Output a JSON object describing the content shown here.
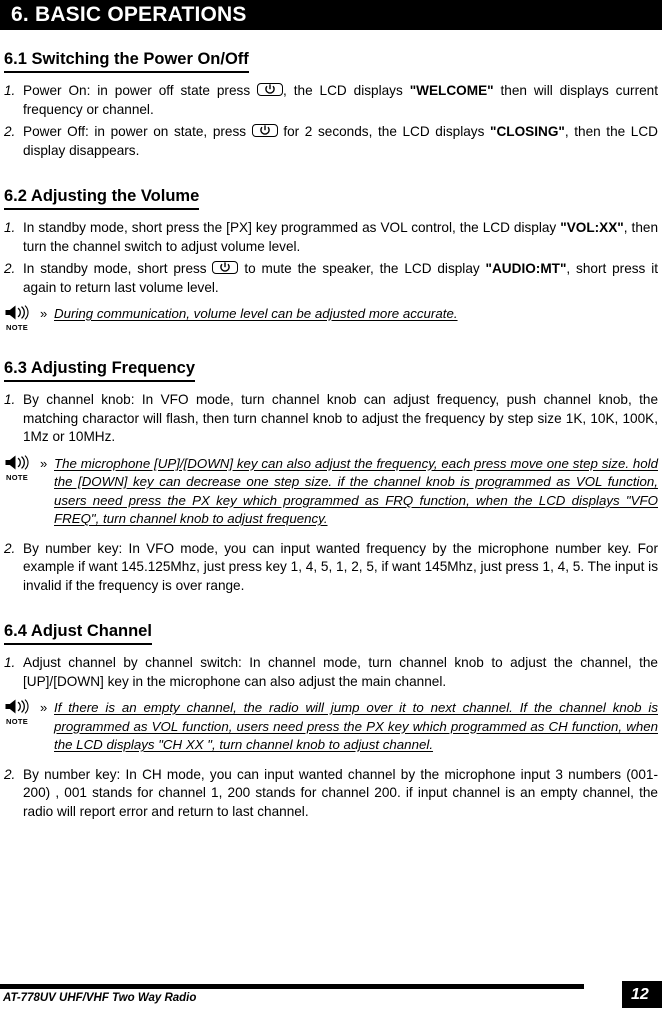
{
  "chapter": {
    "title": "6. BASIC OPERATIONS"
  },
  "sections": {
    "s61": {
      "heading": "6.1 Switching the Power On/Off",
      "item1_num": "1.",
      "item1_a": "Power On: in power off state press",
      "item1_b": ", the LCD displays ",
      "item1_bold": "\"WELCOME\"",
      "item1_c": " then will displays current frequency or channel.",
      "item2_num": "2.",
      "item2_a": "Power Off: in power on state, press",
      "item2_b": " for 2 seconds, the LCD displays ",
      "item2_bold": "\"CLOSING\"",
      "item2_c": ", then the LCD display disappears."
    },
    "s62": {
      "heading": "6.2 Adjusting the Volume",
      "item1_num": "1.",
      "item1_a": "In standby mode, short press the [PX] key programmed as VOL control, the LCD display ",
      "item1_bold": "\"VOL:XX\"",
      "item1_b": ", then turn the channel switch to adjust volume level.",
      "item2_num": "2.",
      "item2_a": "In standby mode, short press",
      "item2_b": " to mute the speaker, the LCD display ",
      "item2_bold": "\"AUDIO:MT\"",
      "item2_c": ", short press it again to return last volume level.",
      "note_text": "During communication, volume level can be adjusted more accurate."
    },
    "s63": {
      "heading": "6.3 Adjusting Frequency",
      "item1_num": "1.",
      "item1_text": "By channel knob: In VFO mode, turn channel knob can adjust frequency,  push channel knob, the matching charactor will flash, then turn channel knob to adjust the frequency by step size 1K, 10K, 100K, 1Mz or 10MHz.",
      "note_text": "The microphone [UP]/[DOWN] key can also adjust the frequency, each press move one step size. hold the [DOWN] key can decrease one step size. if the channel knob is programmed as VOL function, users need press the PX key which programmed as FRQ function, when the LCD displays \"VFO FREQ\",  turn channel knob to adjust frequency.",
      "item2_num": "2.",
      "item2_text": "By number key: In VFO mode, you can input wanted frequency by the microphone number key. For example if want 145.125Mhz, just press key 1, 4, 5, 1, 2, 5, if want 145Mhz, just press 1, 4, 5. The input is invalid if the frequency is over range."
    },
    "s64": {
      "heading": "6.4 Adjust Channel",
      "item1_num": "1.",
      "item1_text": "Adjust channel by channel switch: In channel mode, turn channel knob to adjust the channel, the [UP]/[DOWN] key in the microphone can also adjust the main channel.",
      "note_text": " If there is an empty channel, the radio will jump over it to next channel. If the channel knob is programmed as VOL function, users need press the PX key which programmed as CH function, when the LCD displays \"CH XX \", turn channel knob to adjust channel.",
      "item2_num": "2.",
      "item2_text": "By number key: In CH mode, you can input wanted channel by the microphone input 3 numbers (001-200) ,  001 stands for channel 1, 200 stands for channel 200. if input channel is an empty channel, the radio will report error and return to last channel."
    }
  },
  "note_label": "NOTE",
  "note_marker": "»",
  "footer": {
    "text": "AT-778UV UHF/VHF Two Way Radio",
    "page_number": "12"
  },
  "colors": {
    "ink": "#000000",
    "paper": "#ffffff"
  }
}
